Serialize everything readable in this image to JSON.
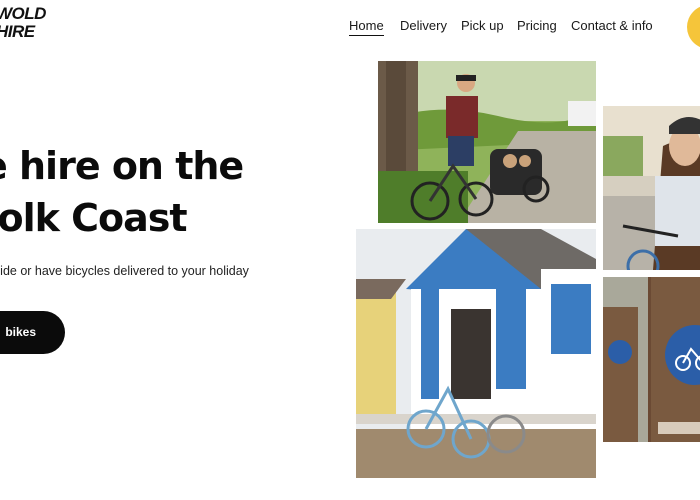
{
  "brand": {
    "line1": "WOLD",
    "line2": "HIRE"
  },
  "nav": {
    "items": [
      {
        "label": "Home"
      },
      {
        "label": "Delivery"
      },
      {
        "label": "Pick up"
      },
      {
        "label": "Pricing"
      },
      {
        "label": "Contact & info"
      }
    ]
  },
  "hero": {
    "title_line1": "e hire on the",
    "title_line2": "folk Coast",
    "subtitle": "ride or have bicycles delivered to your holiday",
    "cta_label": "bikes"
  },
  "colors": {
    "accent": "#f5c53a",
    "cta_bg": "#0b0b0b",
    "sign_blue": "#2b5ea8"
  }
}
